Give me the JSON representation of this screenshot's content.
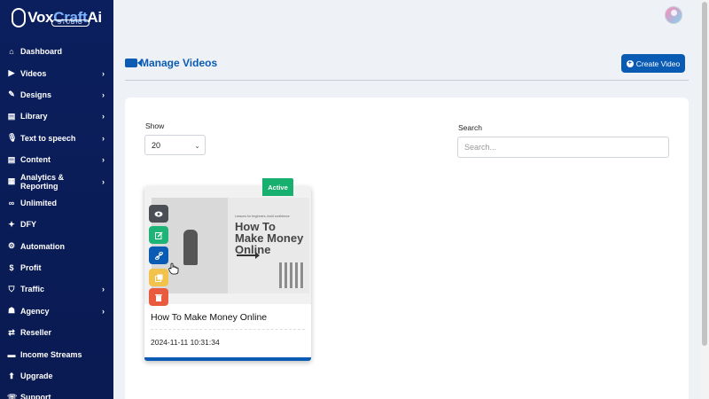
{
  "brand": {
    "name_part1": "Vox",
    "name_part2": "Craft",
    "name_part3": "Ai",
    "subtitle": "STUDIO"
  },
  "sidebar": {
    "items": [
      {
        "label": "Dashboard",
        "icon": "⌂",
        "has_submenu": false
      },
      {
        "label": "Videos",
        "icon": "▶",
        "has_submenu": true
      },
      {
        "label": "Designs",
        "icon": "✎",
        "has_submenu": true
      },
      {
        "label": "Library",
        "icon": "▤",
        "has_submenu": true
      },
      {
        "label": "Text to speech",
        "icon": "🎙",
        "has_submenu": true
      },
      {
        "label": "Content",
        "icon": "▤",
        "has_submenu": true
      },
      {
        "label": "Analytics & Reporting",
        "icon": "▦",
        "has_submenu": true
      },
      {
        "label": "Unlimited",
        "icon": "∞",
        "has_submenu": false
      },
      {
        "label": "DFY",
        "icon": "✦",
        "has_submenu": false
      },
      {
        "label": "Automation",
        "icon": "⚙",
        "has_submenu": false
      },
      {
        "label": "Profit",
        "icon": "$",
        "has_submenu": false
      },
      {
        "label": "Traffic",
        "icon": "⛉",
        "has_submenu": true
      },
      {
        "label": "Agency",
        "icon": "☗",
        "has_submenu": true
      },
      {
        "label": "Reseller",
        "icon": "⇄",
        "has_submenu": false
      },
      {
        "label": "Income Streams",
        "icon": "▬",
        "has_submenu": false
      },
      {
        "label": "Upgrade",
        "icon": "⬆",
        "has_submenu": false
      },
      {
        "label": "Support",
        "icon": "☏",
        "has_submenu": false
      }
    ],
    "chevron": "›"
  },
  "header": {
    "title": "Manage Videos",
    "create_button": "Create Video"
  },
  "filters": {
    "show_label": "Show",
    "show_value": "20",
    "search_label": "Search",
    "search_placeholder": "Search..."
  },
  "videos": [
    {
      "title": "How To Make Money Online",
      "date": "2024-11-11 10:31:34",
      "status": "Active",
      "thumbnail_headline": "How To Make Money Online",
      "thumbnail_caption": "Lessons for beginners, build confidence"
    }
  ],
  "colors": {
    "primary": "#0a5bb4",
    "sidebar": "#0b1f5e",
    "active_badge": "#18b06e",
    "delete": "#ea5a3e",
    "copy": "#f2c34c",
    "edit": "#1fb477",
    "view": "#4b4f55"
  }
}
